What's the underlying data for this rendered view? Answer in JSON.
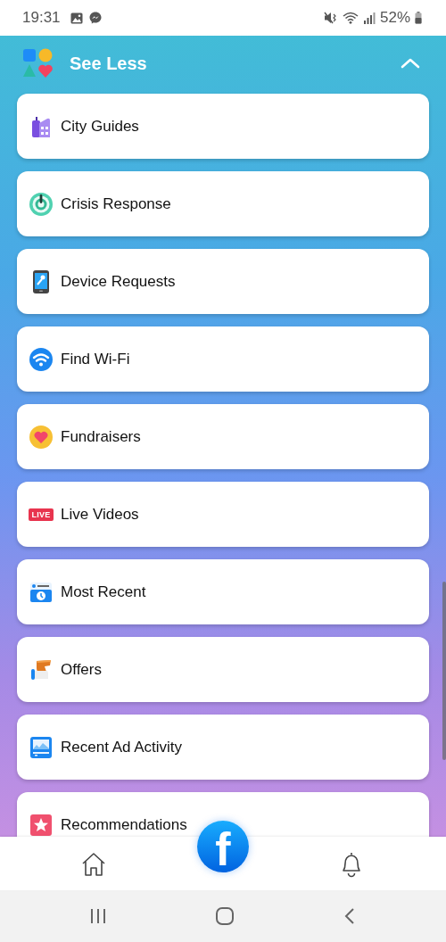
{
  "status_bar": {
    "time": "19:31",
    "battery": "52%"
  },
  "header": {
    "title": "See Less",
    "expanded": true
  },
  "items": [
    {
      "label": "City Guides"
    },
    {
      "label": "Crisis Response"
    },
    {
      "label": "Device Requests"
    },
    {
      "label": "Find Wi-Fi"
    },
    {
      "label": "Fundraisers"
    },
    {
      "label": "Live Videos",
      "badge": "LIVE"
    },
    {
      "label": "Most Recent"
    },
    {
      "label": "Offers"
    },
    {
      "label": "Recent Ad Activity"
    },
    {
      "label": "Recommendations"
    }
  ],
  "bottom_nav": {
    "logo": "f"
  }
}
